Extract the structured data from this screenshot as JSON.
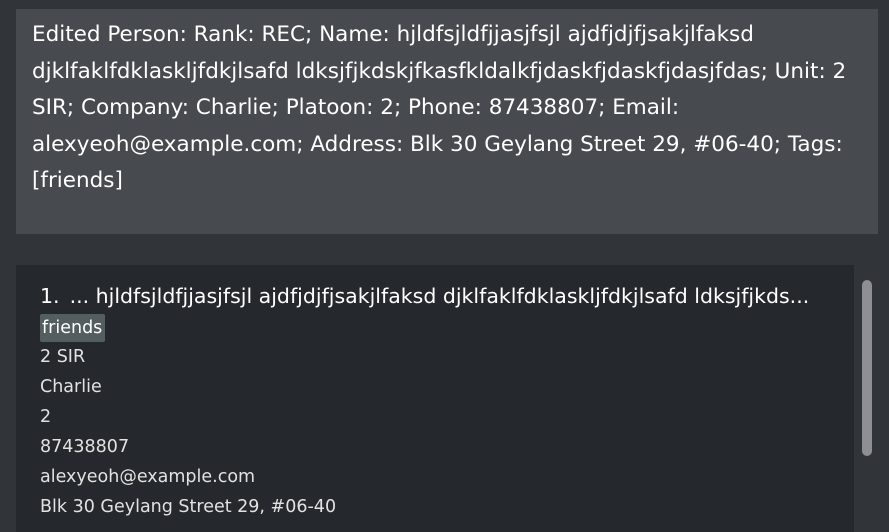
{
  "result_display": {
    "message": "Edited Person: Rank: REC; Name: hjldfsjldfjjasjfsjl ajdfjdjfjsakjlfaksd djklfaklfdklaskljfdkjlsafd ldksjfjkdskjfkasfkldalkfjdaskfjdaskfjdasjfdas; Unit: 2 SIR; Company: Charlie; Platoon: 2; Phone: 87438807; Email: alexyeoh@example.com; Address: Blk 30 Geylang Street 29, #06-40; Tags: [friends]"
  },
  "person_list": {
    "cards": [
      {
        "index": "1.",
        "name": "... hjldfsjldfjjasjfsjl ajdfjdjfjsakjlfaksd djklfaklfdklaskljfdkjlsafd ldksjfjkds...",
        "tag": "friends",
        "unit": "2 SIR",
        "company": "Charlie",
        "platoon": "2",
        "phone": "87438807",
        "email": "alexyeoh@example.com",
        "address": "Blk 30 Geylang Street 29, #06-40"
      }
    ]
  }
}
